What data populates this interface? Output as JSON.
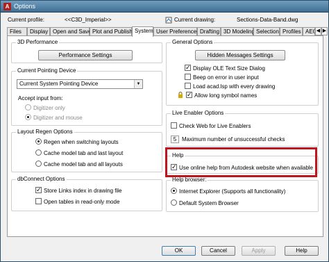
{
  "window": {
    "title": "Options",
    "app_icon": "autocad-icon"
  },
  "profile": {
    "current_profile_label": "Current profile:",
    "current_profile_value": "<<C3D_Imperial>>",
    "current_drawing_label": "Current drawing:",
    "current_drawing_value": "Sections-Data-Band.dwg"
  },
  "tabs": [
    "Files",
    "Display",
    "Open and Save",
    "Plot and Publish",
    "System",
    "User Preferences",
    "Drafting",
    "3D Modeling",
    "Selection",
    "Profiles",
    "AEC"
  ],
  "active_tab": "System",
  "performance": {
    "title": "3D Performance",
    "button": "Performance Settings"
  },
  "pointing": {
    "title": "Current Pointing Device",
    "selected": "Current System Pointing Device",
    "accept_label": "Accept input from:",
    "options": [
      "Digitizer only",
      "Digitizer and mouse"
    ]
  },
  "layout_regen": {
    "title": "Layout Regen Options",
    "options": [
      "Regen when switching layouts",
      "Cache model tab and last layout",
      "Cache model tab and all layouts"
    ]
  },
  "dbconnect": {
    "title": "dbConnect Options",
    "options": [
      "Store Links index in drawing file",
      "Open tables in read-only mode"
    ]
  },
  "general": {
    "title": "General Options",
    "button": "Hidden Messages Settings",
    "options": [
      "Display OLE Text Size Dialog",
      "Beep on error in user input",
      "Load acad.lsp with every drawing",
      "Allow long symbol names"
    ]
  },
  "live_enabler": {
    "title": "Live Enabler Options",
    "check_web": "Check Web for Live Enablers",
    "max_value": "5",
    "max_label": "Maximum number of unsuccessful checks"
  },
  "help": {
    "title": "Help",
    "online": "Use online help from Autodesk website when available"
  },
  "help_browser": {
    "title": "Help browser:",
    "options": [
      "Internet Explorer (Supports all functionality)",
      "Default System Browser"
    ]
  },
  "footer": {
    "ok": "OK",
    "cancel": "Cancel",
    "apply": "Apply",
    "help": "Help"
  },
  "colors": {
    "highlight": "#c2141c",
    "titlebar": "#4f7fa5"
  }
}
